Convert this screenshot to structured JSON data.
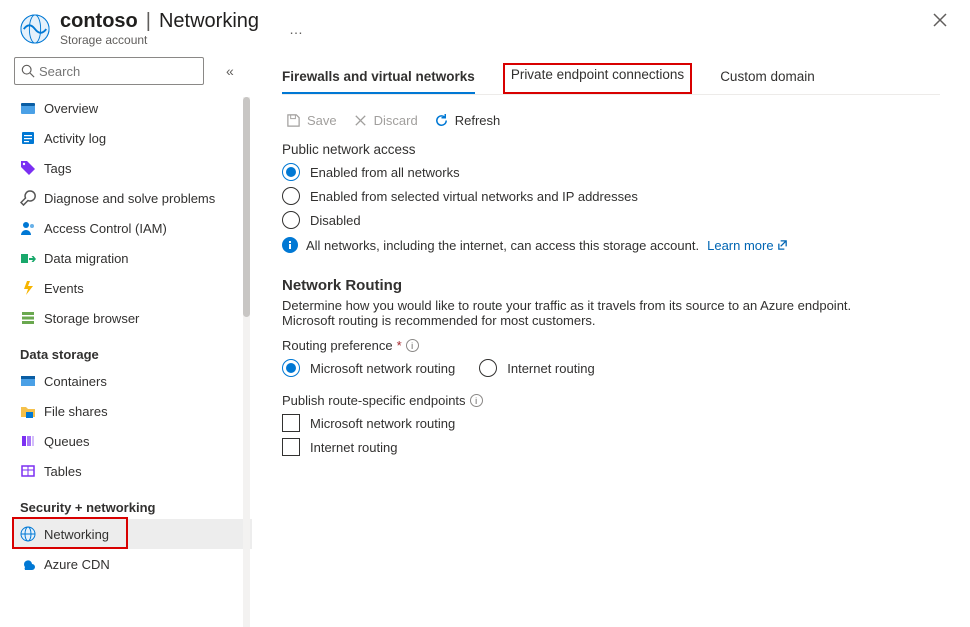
{
  "header": {
    "account": "contoso",
    "section": "Networking",
    "subtitle": "Storage account",
    "more": "…"
  },
  "search": {
    "placeholder": "Search"
  },
  "sidebar": {
    "items": [
      {
        "id": "overview",
        "label": "Overview"
      },
      {
        "id": "activity",
        "label": "Activity log"
      },
      {
        "id": "tags",
        "label": "Tags"
      },
      {
        "id": "diagnose",
        "label": "Diagnose and solve problems"
      },
      {
        "id": "iam",
        "label": "Access Control (IAM)"
      },
      {
        "id": "migration",
        "label": "Data migration"
      },
      {
        "id": "events",
        "label": "Events"
      },
      {
        "id": "browser",
        "label": "Storage browser"
      }
    ],
    "group_data_storage": "Data storage",
    "data_storage": [
      {
        "id": "containers",
        "label": "Containers"
      },
      {
        "id": "fileshares",
        "label": "File shares"
      },
      {
        "id": "queues",
        "label": "Queues"
      },
      {
        "id": "tables",
        "label": "Tables"
      }
    ],
    "group_security": "Security + networking",
    "security": [
      {
        "id": "networking",
        "label": "Networking",
        "selected": true
      },
      {
        "id": "cdn",
        "label": "Azure CDN"
      }
    ]
  },
  "tabs": {
    "firewalls": "Firewalls and virtual networks",
    "private": "Private endpoint connections",
    "custom": "Custom domain"
  },
  "toolbar": {
    "save": "Save",
    "discard": "Discard",
    "refresh": "Refresh"
  },
  "publicAccess": {
    "label": "Public network access",
    "opt_all": "Enabled from all networks",
    "opt_selected": "Enabled from selected virtual networks and IP addresses",
    "opt_disabled": "Disabled",
    "info_text": "All networks, including the internet, can access this storage account.",
    "learn_more": "Learn more"
  },
  "routing": {
    "heading": "Network Routing",
    "desc": "Determine how you would like to route your traffic as it travels from its source to an Azure endpoint. Microsoft routing is recommended for most customers.",
    "pref_label": "Routing preference",
    "opt_ms": "Microsoft network routing",
    "opt_inet": "Internet routing",
    "publish_label": "Publish route-specific endpoints",
    "chk_ms": "Microsoft network routing",
    "chk_inet": "Internet routing"
  }
}
